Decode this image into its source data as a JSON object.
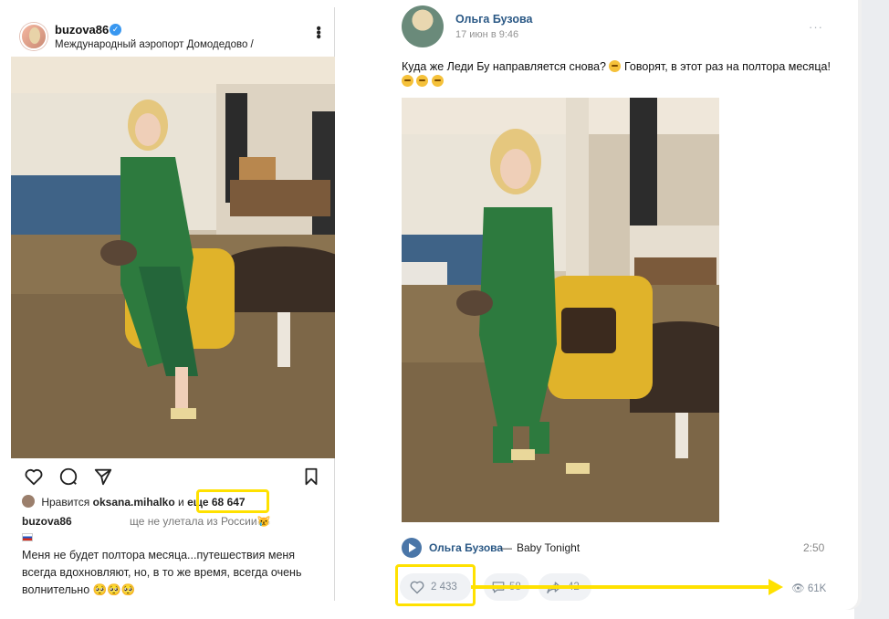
{
  "instagram": {
    "username": "buzova86",
    "location": "Международный аэропорт Домодедово /",
    "likes_prefix": "Нравится",
    "likes_user": "oksana.mihalko",
    "likes_and": "и",
    "likes_more": "еще 68 647",
    "caption_user": "buzova86",
    "caption_tail": "ще не улетала из России😿",
    "caption_body": "Меня не будет полтора месяца...путешествия меня всегда вдохновляют, но, в то же время, всегда очень волнительно 🥺🥺🥺",
    "icons": [
      "heart-icon",
      "comment-icon",
      "send-icon",
      "bookmark-icon",
      "more-icon",
      "verified-icon"
    ]
  },
  "vk": {
    "author": "Ольга Бузова",
    "date": "17 июн в 9:46",
    "menu": "···",
    "text_line1": "Куда же Леди Бу направляется снова?",
    "text_line1b": "Говорят, в этот раз на полтора месяца!",
    "audio": {
      "artist": "Ольга Бузова",
      "dash": "—",
      "title": "Baby Tonight",
      "duration": "2:50"
    },
    "likes": "2 433",
    "comments": "58",
    "shares": "42",
    "views": "61K"
  },
  "colors": {
    "highlight": "#ffe100",
    "vk_link": "#2a5885",
    "vk_button_bg": "#f0f2f5"
  }
}
